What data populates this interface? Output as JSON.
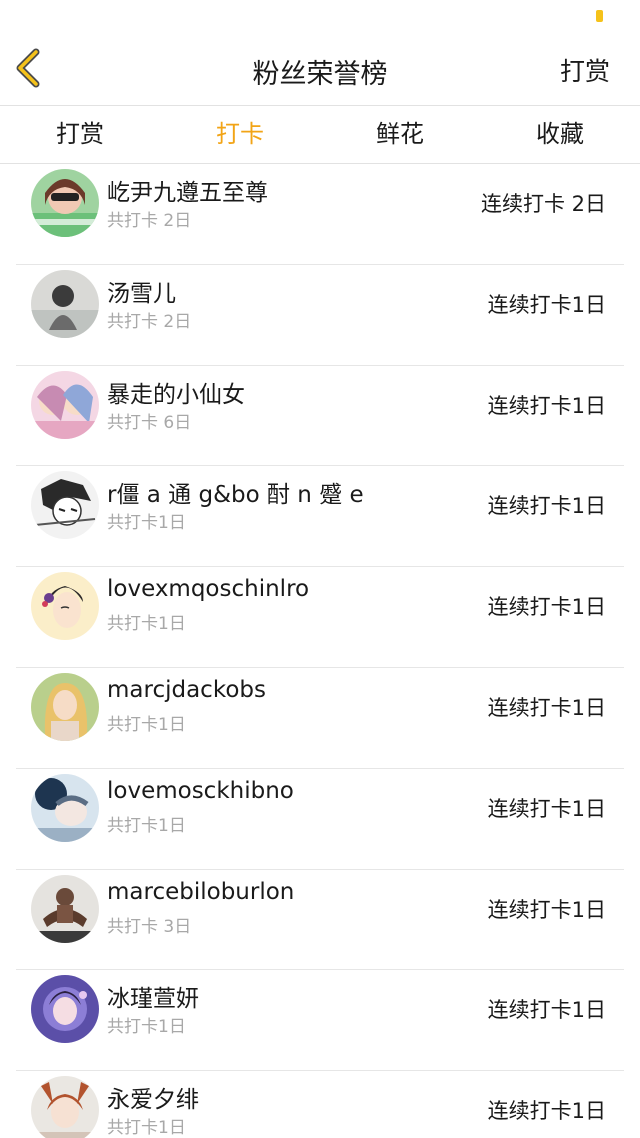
{
  "nav": {
    "title": "粉丝荣誉榜",
    "right_action": "打赏",
    "back_icon": "chevron-left-icon",
    "accent_color": "#f2a416"
  },
  "tabs": [
    {
      "label": "打赏",
      "active": false
    },
    {
      "label": "打卡",
      "active": true
    },
    {
      "label": "鲜花",
      "active": false
    },
    {
      "label": "收藏",
      "active": false
    }
  ],
  "list": [
    {
      "name": "屹尹九遵五至尊",
      "total": "共打卡 2日",
      "streak": "连续打卡 2日"
    },
    {
      "name": "汤雪儿",
      "total": "共打卡 2日",
      "streak": "连续打卡1日"
    },
    {
      "name": "暴走的小仙女",
      "total": "共打卡 6日",
      "streak": "连续打卡1日"
    },
    {
      "name": "r僵 a 通 g&bo 酎 n 蹙 e",
      "total": "共打卡1日",
      "streak": "连续打卡1日"
    },
    {
      "name": "lovexmqoschinlro",
      "total": "共打卡1日",
      "streak": "连续打卡1日"
    },
    {
      "name": "marcjdackobs",
      "total": "共打卡1日",
      "streak": "连续打卡1日"
    },
    {
      "name": "lovemosckhibno",
      "total": "共打卡1日",
      "streak": "连续打卡1日"
    },
    {
      "name": "marcebiloburlon",
      "total": "共打卡 3日",
      "streak": "连续打卡1日"
    },
    {
      "name": "冰瑾萱妍",
      "total": "共打卡1日",
      "streak": "连续打卡1日"
    },
    {
      "name": "永爱夕绯",
      "total": "共打卡1日",
      "streak": "连续打卡1日"
    }
  ]
}
